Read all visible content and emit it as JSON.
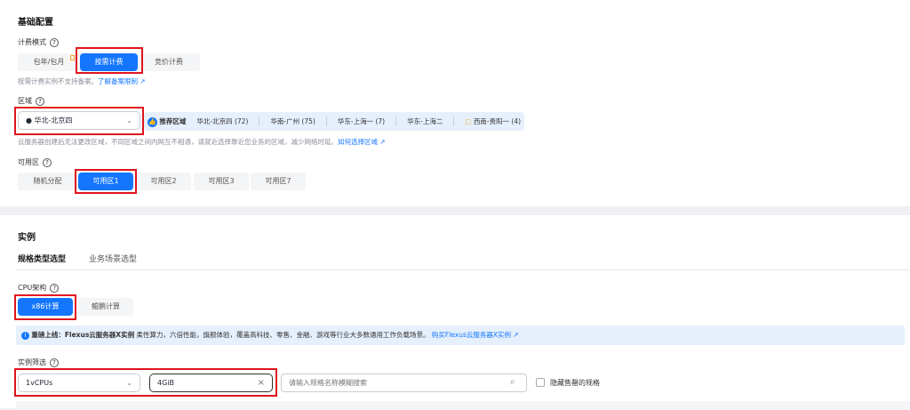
{
  "basic": {
    "title": "基础配置",
    "billing": {
      "label": "计费模式",
      "options": [
        "包年/包月",
        "按需计费",
        "竞价计费"
      ],
      "note": "按需计费实例不支持备案。",
      "note_link": "了解备案限制"
    },
    "region": {
      "label": "区域",
      "selected": "华北-北京四",
      "recommend_label": "推荐区域",
      "recommended": [
        "华北-北京四 (72)",
        "华南-广州 (75)",
        "华东-上海一 (7)",
        "华东-上海二",
        "西南-贵阳一 (4)"
      ],
      "note": "云服务器创建后无法更改区域，不同区域之间内网互不相通，请就近选择靠近您业务的区域，减少网络时延。",
      "note_link": "如何选择区域"
    },
    "az": {
      "label": "可用区",
      "options": [
        "随机分配",
        "可用区1",
        "可用区2",
        "可用区3",
        "可用区7"
      ]
    }
  },
  "instance": {
    "title": "实例",
    "tabs": [
      "规格类型选型",
      "业务场景选型"
    ],
    "cpu": {
      "label": "CPU架构",
      "options": [
        "x86计算",
        "鲲鹏计算"
      ]
    },
    "info": {
      "bold": "重磅上线：Flexus云服务器X实例",
      "text": " 柔性算力，六倍性能，旗舰体验，覆盖高科技、零售、金融、游戏等行业大多数通用工作负载场景。",
      "link": "购买Flexus云服务器X实例"
    },
    "filter": {
      "label": "实例筛选",
      "vcpu": "1vCPUs",
      "memory": "4GiB",
      "search_placeholder": "请输入规格名称模糊搜索",
      "hide_label": "隐藏售罄的规格"
    }
  },
  "colors": {
    "accent": "#1476ff",
    "highlight": "#e0141e"
  }
}
